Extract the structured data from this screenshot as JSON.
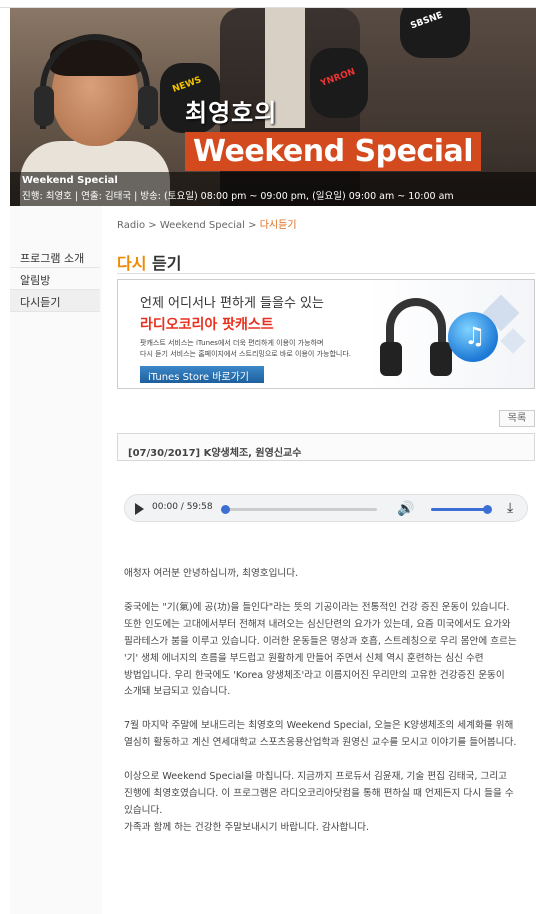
{
  "banner": {
    "title_ko": "최영호의",
    "title_en": "Weekend Special",
    "mic_tags": [
      "NEWS",
      "YNRON",
      "SBSNE"
    ],
    "program_name": "Weekend Special",
    "meta": "진행: 최영호 | 연출: 김태국 | 방송: (토요일) 08:00 pm ~ 09:00 pm, (일요일) 09:00 am ~ 10:00 am"
  },
  "sidebar": {
    "items": [
      {
        "label": "프로그램 소개"
      },
      {
        "label": "알림방"
      },
      {
        "label": "다시듣기",
        "active": true
      }
    ]
  },
  "breadcrumb": {
    "root": "Radio",
    "sep": ">",
    "program": "Weekend Special",
    "current": "다시듣기"
  },
  "heading": {
    "accent": "다시",
    "rest": " 듣기"
  },
  "podcast": {
    "line1": "언제 어디서나 편하게 들을수 있는",
    "line2": "라디오코리아 팟캐스트",
    "line3": "팟캐스트 서비스는 iTunes에서 더욱 편리하게 이용이 가능하며",
    "line4": "다시 듣기 서비스는 홈페이지에서 스트리밍으로 바로 이용이 가능합니다.",
    "button": "iTunes Store 바로가기"
  },
  "list_button": "목록",
  "episode": {
    "title": "[07/30/2017] K양생체조, 원영신교수"
  },
  "player": {
    "current_time": "00:00",
    "duration": "59:58",
    "time_display": "00:00 / 59:58",
    "progress": 0,
    "volume": 1.0
  },
  "article": {
    "paragraphs": [
      "애청자 여러분 안녕하십니까, 최영호입니다.",
      "중국에는 \"기(氣)에 공(功)을 들인다\"라는 뜻의 기공이라는 전통적인 건강 증진 운동이 있습니다. 또한 인도에는 고대에서부터 전해져 내려오는 심신단련의 요가가 있는데, 요즘 미국에서도 요가와 필라테스가 붐을 이루고 있습니다. 이러한 운동들은 명상과 호흡, 스트레칭으로 우리 몸안에 흐르는 '기' 생체 에너지의 흐름을 부드럽고 원활하게 만들어 주면서 신체 역시 훈련하는 심신 수련 방법입니다. 우리 한국에도 'Korea 양생체조'라고 이름지어진 우리만의 고유한 건강증진 운동이 소개돼 보급되고 있습니다.",
      "7월 마지막 주말에 보내드리는 최영호의 Weekend Special, 오늘은 K양생체조의 세계화를 위해 열심히 활동하고 계신 연세대학교 스포츠응용산업학과 원영신 교수를 모시고 이야기를 들어봅니다.",
      "이상으로 Weekend Special을 마칩니다. 지금까지 프로듀서 김윤재, 기술 편집 김태국, 그리고 진행에 최영호였습니다. 이 프로그램은 라디오코리아닷컴을 통해 편하실 때 언제든지 다시 들을 수 있습니다.",
      "가족과 함께 하는 건강한 주말보내시기 바랍니다. 감사합니다."
    ]
  }
}
